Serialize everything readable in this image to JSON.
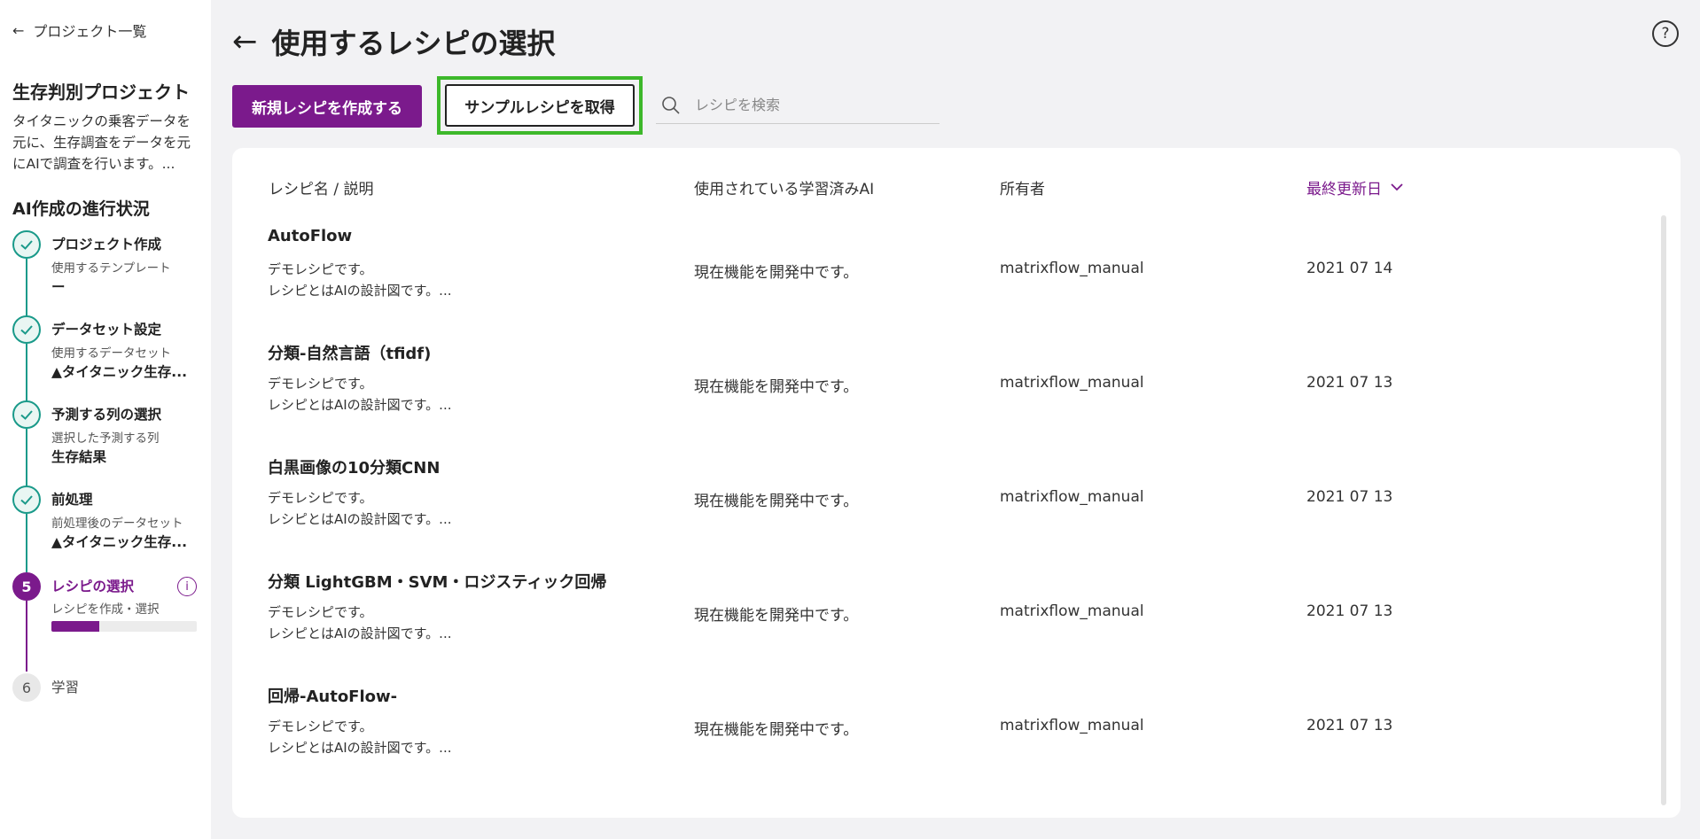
{
  "sidebar": {
    "back_label": "プロジェクト一覧",
    "project_title": "生存判別プロジェクト",
    "project_desc": "タイタニックの乗客データを元に、生存調査をデータを元にAIで調査を行います。...",
    "progress_title": "AI作成の進行状況",
    "steps": [
      {
        "label": "プロジェクト作成",
        "sub": "使用するテンプレート",
        "value": "ー",
        "status": "done"
      },
      {
        "label": "データセット設定",
        "sub": "使用するデータセット",
        "value": "▲タイタニック生存...",
        "status": "done"
      },
      {
        "label": "予測する列の選択",
        "sub": "選択した予測する列",
        "value": "生存結果",
        "status": "done"
      },
      {
        "label": "前処理",
        "sub": "前処理後のデータセット",
        "value": "▲タイタニック生存...",
        "status": "done"
      },
      {
        "number": "5",
        "label": "レシピの選択",
        "sub": "レシピを作成・選択",
        "progress": 0.33,
        "status": "active"
      },
      {
        "number": "6",
        "label": "学習",
        "status": "pending"
      }
    ]
  },
  "header": {
    "title": "使用するレシピの選択"
  },
  "toolbar": {
    "new_label": "新規レシピを作成する",
    "sample_label": "サンプルレシピを取得",
    "search_placeholder": "レシピを検索"
  },
  "table": {
    "columns": {
      "name": "レシピ名 / 説明",
      "ai": "使用されている学習済みAI",
      "owner": "所有者",
      "updated": "最終更新日"
    },
    "rows": [
      {
        "name": "AutoFlow",
        "desc1": "デモレシピです。",
        "desc2": "レシピとはAIの設計図です。...",
        "ai": "現在機能を開発中です。",
        "owner": "matrixflow_manual",
        "date": "2021 07 14"
      },
      {
        "name": "分類-自然言語（tfidf)",
        "desc1": "デモレシピです。",
        "desc2": "レシピとはAIの設計図です。...",
        "ai": "現在機能を開発中です。",
        "owner": "matrixflow_manual",
        "date": "2021 07 13"
      },
      {
        "name": "白黒画像の10分類CNN",
        "desc1": "デモレシピです。",
        "desc2": "レシピとはAIの設計図です。...",
        "ai": "現在機能を開発中です。",
        "owner": "matrixflow_manual",
        "date": "2021 07 13"
      },
      {
        "name": "分類 LightGBM・SVM・ロジスティック回帰",
        "desc1": "デモレシピです。",
        "desc2": "レシピとはAIの設計図です。...",
        "ai": "現在機能を開発中です。",
        "owner": "matrixflow_manual",
        "date": "2021 07 13"
      },
      {
        "name": "回帰-AutoFlow-",
        "desc1": "デモレシピです。",
        "desc2": "レシピとはAIの設計図です。...",
        "ai": "現在機能を開発中です。",
        "owner": "matrixflow_manual",
        "date": "2021 07 13"
      }
    ]
  },
  "colors": {
    "accent": "#7b1a8c",
    "done": "#1a9a8a",
    "highlight": "#3db82a"
  }
}
